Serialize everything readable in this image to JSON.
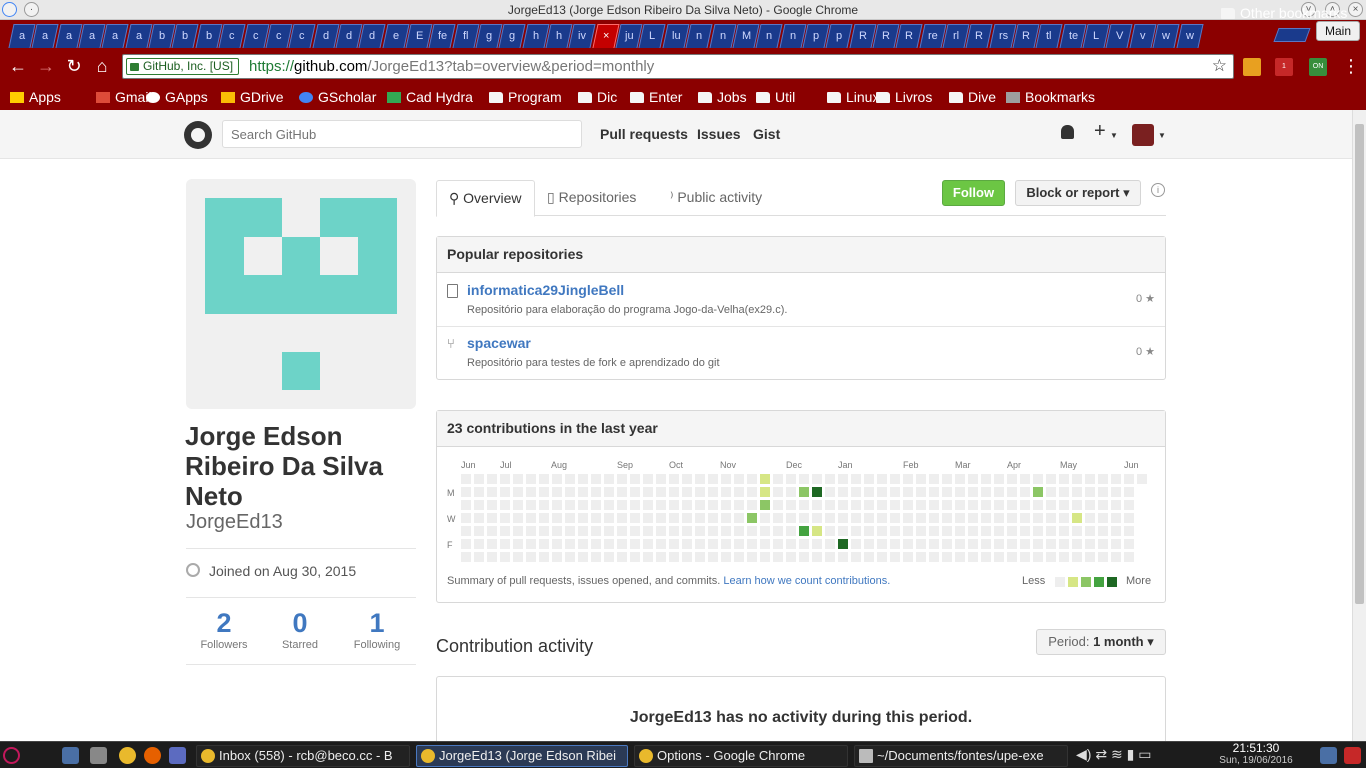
{
  "window": {
    "title": "JorgeEd13 (Jorge Edson Ribeiro Da Silva Neto) - Google Chrome"
  },
  "tabs": {
    "labels": [
      "a",
      "a",
      "a",
      "a",
      "a",
      "a",
      "b",
      "b",
      "b",
      "c",
      "c",
      "c",
      "c",
      "d",
      "d",
      "d",
      "e",
      "E",
      "fe",
      "fl",
      "g",
      "g",
      "h",
      "h",
      "iv",
      "×",
      "ju",
      "L",
      "lu",
      "n",
      "n",
      "M",
      "n",
      "n",
      "p",
      "p",
      "R",
      "R",
      "R",
      "re",
      "rl",
      "R",
      "rs",
      "R",
      "tl",
      "te",
      "L",
      "V",
      "v",
      "w",
      "w"
    ],
    "profile": "Main"
  },
  "toolbar": {
    "ev_label": "GitHub, Inc. [US]",
    "url_scheme": "https://",
    "url_host": "github.com",
    "url_rest": "/JorgeEd13?tab=overview&period=monthly",
    "ext2_badge": "1",
    "ext3_badge": "ON"
  },
  "bookmarks": [
    "Apps",
    "Gmail",
    "GApps",
    "GDrive",
    "GScholar",
    "Cad Hydra",
    "Program",
    "Dic",
    "Enter",
    "Jobs",
    "Util",
    "Linux",
    "Livros",
    "Dive",
    "Bookmarks"
  ],
  "bookmarks_other": "Other bookmarks",
  "github": {
    "search_placeholder": "Search GitHub",
    "nav": {
      "pulls": "Pull requests",
      "issues": "Issues",
      "gist": "Gist"
    },
    "profile": {
      "fullname": "Jorge Edson Ribeiro Da Silva Neto",
      "login": "JorgeEd13",
      "joined": "Joined on Aug 30, 2015",
      "stats": [
        {
          "n": "2",
          "l": "Followers"
        },
        {
          "n": "0",
          "l": "Starred"
        },
        {
          "n": "1",
          "l": "Following"
        }
      ]
    },
    "tabs": [
      "Overview",
      "Repositories",
      "Public activity"
    ],
    "follow": "Follow",
    "block": "Block or report ▾",
    "info": "i",
    "popular": {
      "title": "Popular repositories",
      "repos": [
        {
          "name": "informatica29JingleBell",
          "desc": "Repositório para elaboração do programa Jogo-da-Velha(ex29.c).",
          "stars": "0 ★"
        },
        {
          "name": "spacewar",
          "desc": "Repositório para testes de fork e aprendizado do git",
          "stars": "0 ★"
        }
      ]
    },
    "contrib": {
      "title": "23 contributions in the last year",
      "months": [
        "Jun",
        "Jul",
        "Aug",
        "Sep",
        "Oct",
        "Nov",
        "Dec",
        "Jan",
        "Feb",
        "Mar",
        "Apr",
        "May",
        "Jun"
      ],
      "days": [
        "M",
        "W",
        "F"
      ],
      "summary": "Summary of pull requests, issues opened, and commits.",
      "learn": "Learn how we count contributions.",
      "less": "Less",
      "more": "More",
      "levels": [
        "#eeeeee",
        "#d6e685",
        "#8cc665",
        "#44a340",
        "#1e6823"
      ],
      "cells": [
        [
          23,
          0,
          1
        ],
        [
          23,
          1,
          1
        ],
        [
          23,
          2,
          2
        ],
        [
          22,
          3,
          2
        ],
        [
          26,
          1,
          2
        ],
        [
          27,
          1,
          4
        ],
        [
          26,
          4,
          3
        ],
        [
          27,
          4,
          1
        ],
        [
          29,
          5,
          4
        ],
        [
          44,
          1,
          2
        ],
        [
          47,
          3,
          1
        ]
      ]
    },
    "activity": {
      "title": "Contribution activity",
      "period_label": "Period:",
      "period_value": "1 month ▾",
      "empty": "JorgeEd13 has no activity during this period."
    }
  },
  "taskbar": {
    "tasks": [
      "Inbox (558) - rcb@beco.cc - B",
      "JorgeEd13 (Jorge Edson Ribei",
      "Options - Google Chrome",
      "~/Documents/fontes/upe-exe"
    ],
    "time": "21:51:30",
    "date": "Sun, 19/06/2016"
  }
}
